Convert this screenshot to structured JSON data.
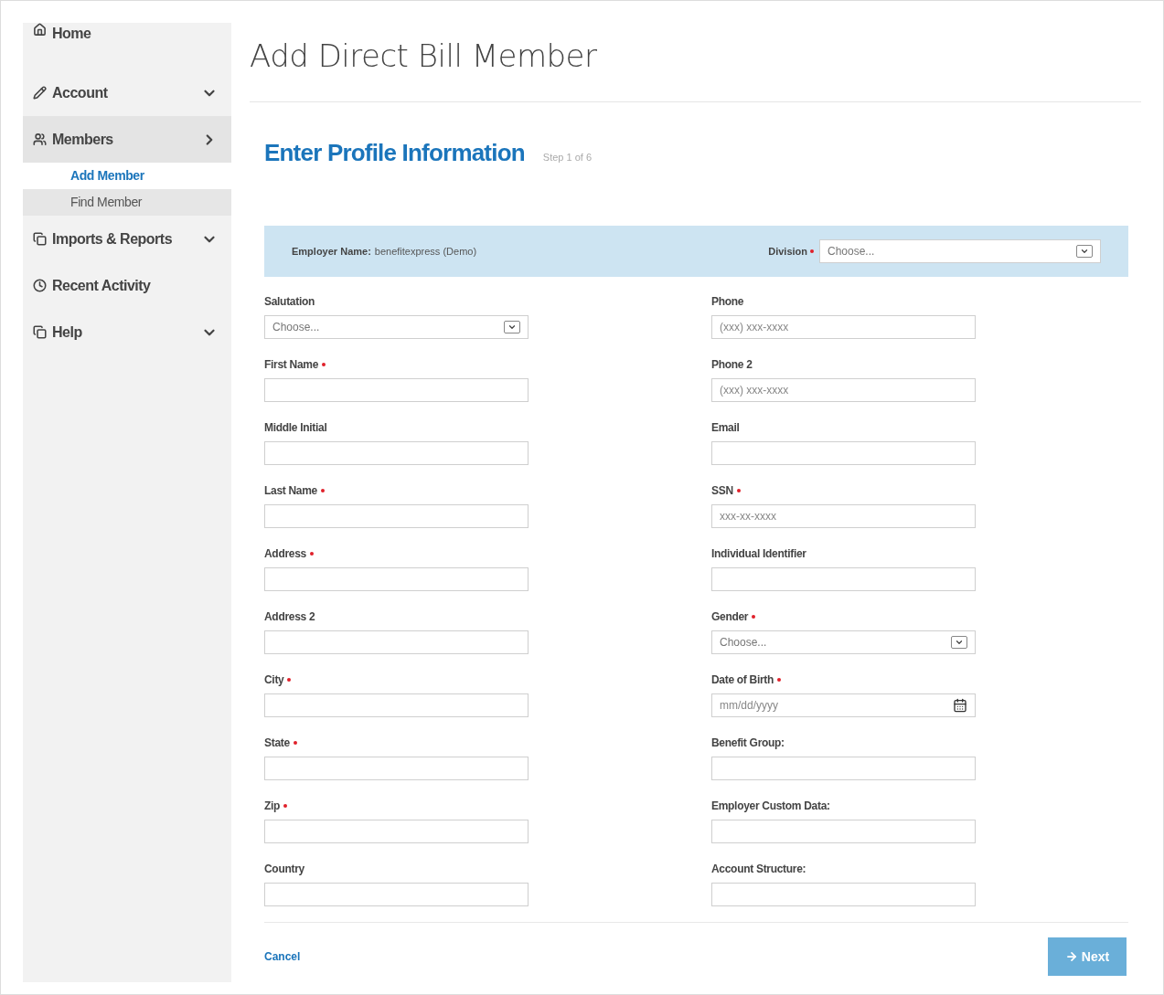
{
  "sidebar": {
    "items": [
      {
        "label": "Home",
        "selected": false
      },
      {
        "label": "Account",
        "selected": false,
        "expanded": false
      },
      {
        "label": "Members",
        "selected": true,
        "expanded": true,
        "children": [
          {
            "label": "Add Member",
            "selected": true
          },
          {
            "label": "Find Member",
            "selected": false
          }
        ]
      },
      {
        "label": "Imports & Reports",
        "selected": false,
        "expanded": false
      },
      {
        "label": "Recent Activity",
        "selected": false
      },
      {
        "label": "Help",
        "selected": false,
        "expanded": false
      }
    ]
  },
  "page_title": "Add Direct Bill Member",
  "section": {
    "title": "Enter Profile Information",
    "step": "Step 1 of 6"
  },
  "employer_bar": {
    "employer_label": "Employer Name:",
    "employer_value": "benefitexpress (Demo)",
    "division": {
      "label": "Division",
      "required": true,
      "placeholder": "Choose..."
    }
  },
  "form": {
    "left": [
      {
        "label": "Salutation",
        "kind": "select",
        "required": false,
        "placeholder": "Choose..."
      },
      {
        "label": "First Name",
        "kind": "text",
        "required": true
      },
      {
        "label": "Middle Initial",
        "kind": "text",
        "required": false
      },
      {
        "label": "Last Name",
        "kind": "text",
        "required": true
      },
      {
        "label": "Address",
        "kind": "text",
        "required": true
      },
      {
        "label": "Address 2",
        "kind": "text",
        "required": false
      },
      {
        "label": "City",
        "kind": "text",
        "required": true
      },
      {
        "label": "State",
        "kind": "text",
        "required": true
      },
      {
        "label": "Zip",
        "kind": "text",
        "required": true
      },
      {
        "label": "Country",
        "kind": "text",
        "required": false
      }
    ],
    "right": [
      {
        "label": "Phone",
        "kind": "text",
        "required": false,
        "placeholder": "(xxx) xxx-xxxx"
      },
      {
        "label": "Phone 2",
        "kind": "text",
        "required": false,
        "placeholder": "(xxx) xxx-xxxx"
      },
      {
        "label": "Email",
        "kind": "text",
        "required": false
      },
      {
        "label": "SSN",
        "kind": "text",
        "required": true,
        "placeholder": "xxx-xx-xxxx"
      },
      {
        "label": "Individual Identifier",
        "kind": "text",
        "required": false
      },
      {
        "label": "Gender",
        "kind": "select",
        "required": true,
        "placeholder": "Choose..."
      },
      {
        "label": "Date of Birth",
        "kind": "date",
        "required": true,
        "placeholder": "mm/dd/yyyy"
      },
      {
        "label": "Benefit Group:",
        "kind": "text",
        "required": false
      },
      {
        "label": "Employer Custom Data:",
        "kind": "text",
        "required": false
      },
      {
        "label": "Account Structure:",
        "kind": "text",
        "required": false
      }
    ]
  },
  "footer": {
    "cancel": "Cancel",
    "next": "Next"
  }
}
